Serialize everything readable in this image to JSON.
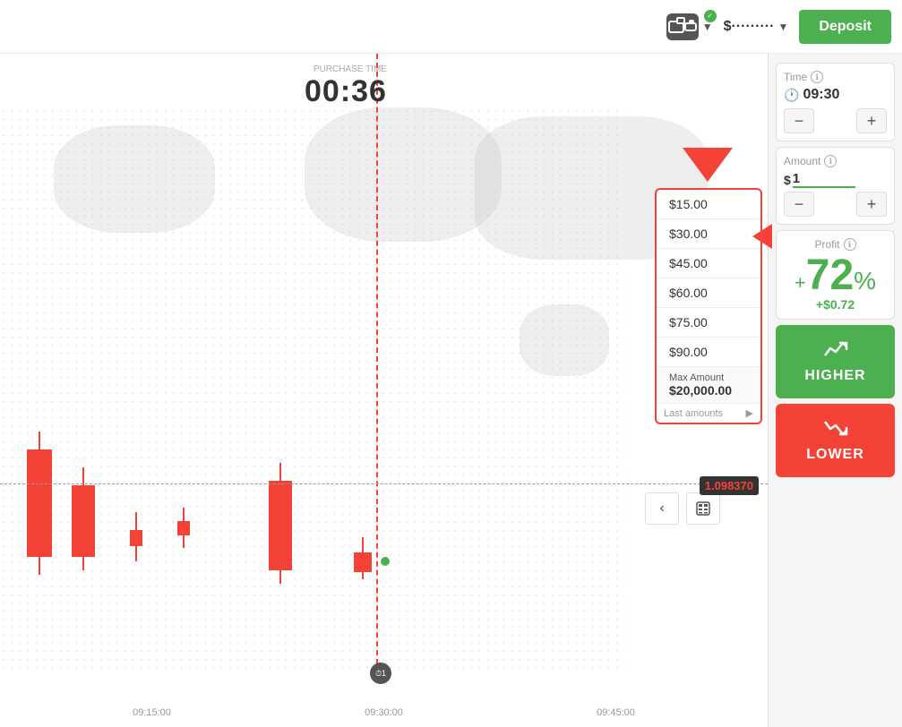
{
  "header": {
    "balance_label": "$·········",
    "deposit_label": "Deposit"
  },
  "sidebar": {
    "time_label": "Time",
    "time_value": "09:30",
    "amount_label": "Amount",
    "amount_value": "1",
    "amount_dollar": "$",
    "profit_label": "Profit",
    "profit_info": "ℹ",
    "profit_percent": "+72",
    "profit_percent_sign": "%",
    "profit_money": "+$0.72",
    "stepper_minus": "−",
    "stepper_plus": "+",
    "higher_label": "HIGHER",
    "lower_label": "LOWER"
  },
  "chart": {
    "purchase_time_label": "PURCHASE TIME",
    "purchase_time_value": "00:36",
    "price_value": "1.0983",
    "price_highlight": "70",
    "x_labels": [
      "09:15:00",
      "09:30:00",
      "09:45:00"
    ]
  },
  "dropdown": {
    "items": [
      {
        "value": "$15.00"
      },
      {
        "value": "$30.00"
      },
      {
        "value": "$45.00"
      },
      {
        "value": "$60.00"
      },
      {
        "value": "$75.00"
      },
      {
        "value": "$90.00"
      }
    ],
    "max_label": "Max Amount",
    "max_value": "$20,000.00",
    "last_amounts_label": "Last amounts"
  },
  "nav_buttons": {
    "back": "‹",
    "calc": "⊞"
  }
}
